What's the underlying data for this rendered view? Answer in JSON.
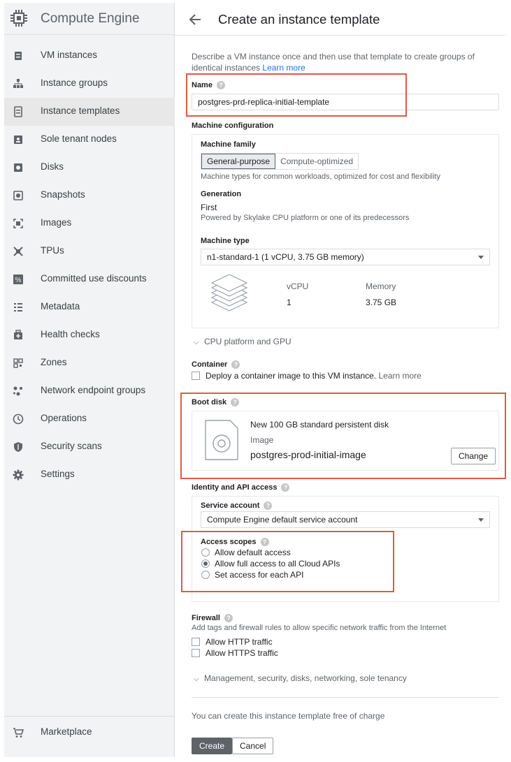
{
  "app": {
    "title": "Compute Engine"
  },
  "sidebar": {
    "items": [
      {
        "label": "VM instances",
        "icon": "vm-instance-icon"
      },
      {
        "label": "Instance groups",
        "icon": "instance-groups-icon"
      },
      {
        "label": "Instance templates",
        "icon": "instance-templates-icon",
        "active": true
      },
      {
        "label": "Sole tenant nodes",
        "icon": "sole-tenant-icon"
      },
      {
        "label": "Disks",
        "icon": "disk-icon"
      },
      {
        "label": "Snapshots",
        "icon": "snapshot-icon"
      },
      {
        "label": "Images",
        "icon": "images-icon"
      },
      {
        "label": "TPUs",
        "icon": "tpu-icon"
      },
      {
        "label": "Committed use discounts",
        "icon": "percent-icon"
      },
      {
        "label": "Metadata",
        "icon": "metadata-icon"
      },
      {
        "label": "Health checks",
        "icon": "health-check-icon"
      },
      {
        "label": "Zones",
        "icon": "zones-icon"
      },
      {
        "label": "Network endpoint groups",
        "icon": "network-endpoint-icon"
      },
      {
        "label": "Operations",
        "icon": "clock-icon"
      },
      {
        "label": "Security scans",
        "icon": "shield-icon"
      },
      {
        "label": "Settings",
        "icon": "gear-icon"
      }
    ],
    "marketplace": {
      "label": "Marketplace",
      "icon": "cart-icon"
    }
  },
  "header": {
    "title": "Create an instance template"
  },
  "form": {
    "description": "Describe a VM instance once and then use that template to create groups of identical instances",
    "learn_more": "Learn more",
    "name": {
      "label": "Name",
      "value": "postgres-prd-replica-initial-template"
    },
    "machine": {
      "section_label": "Machine configuration",
      "family_label": "Machine family",
      "family_options": [
        "General-purpose",
        "Compute-optimized"
      ],
      "family_selected": "General-purpose",
      "family_desc": "Machine types for common workloads, optimized for cost and flexibility",
      "generation_label": "Generation",
      "generation_value": "First",
      "generation_desc": "Powered by Skylake CPU platform or one of its predecessors",
      "type_label": "Machine type",
      "type_value": "n1-standard-1 (1 vCPU, 3.75 GB memory)",
      "vcpu_label": "vCPU",
      "vcpu_value": "1",
      "memory_label": "Memory",
      "memory_value": "3.75 GB"
    },
    "cpu_platform_expander": "CPU platform and GPU",
    "container": {
      "label": "Container",
      "checkbox_label": "Deploy a container image to this VM instance.",
      "learn_more": "Learn more"
    },
    "boot_disk": {
      "label": "Boot disk",
      "summary": "New 100 GB standard persistent disk",
      "image_label": "Image",
      "image_value": "postgres-prod-initial-image",
      "change_button": "Change"
    },
    "identity": {
      "label": "Identity and API access",
      "service_account_label": "Service account",
      "service_account_value": "Compute Engine default service account",
      "scopes_label": "Access scopes",
      "scopes": [
        {
          "label": "Allow default access",
          "selected": false
        },
        {
          "label": "Allow full access to all Cloud APIs",
          "selected": true
        },
        {
          "label": "Set access for each API",
          "selected": false
        }
      ]
    },
    "firewall": {
      "label": "Firewall",
      "desc": "Add tags and firewall rules to allow specific network traffic from the Internet",
      "http": "Allow HTTP traffic",
      "https": "Allow HTTPS traffic"
    },
    "management_expander": "Management, security, disks, networking, sole tenancy",
    "free_note": "You can create this instance template free of charge",
    "create_button": "Create",
    "cancel_button": "Cancel"
  },
  "colors": {
    "highlight": "#e25a44",
    "accent": "#1a73e8",
    "sidebar_bg": "#f1f3f4"
  }
}
